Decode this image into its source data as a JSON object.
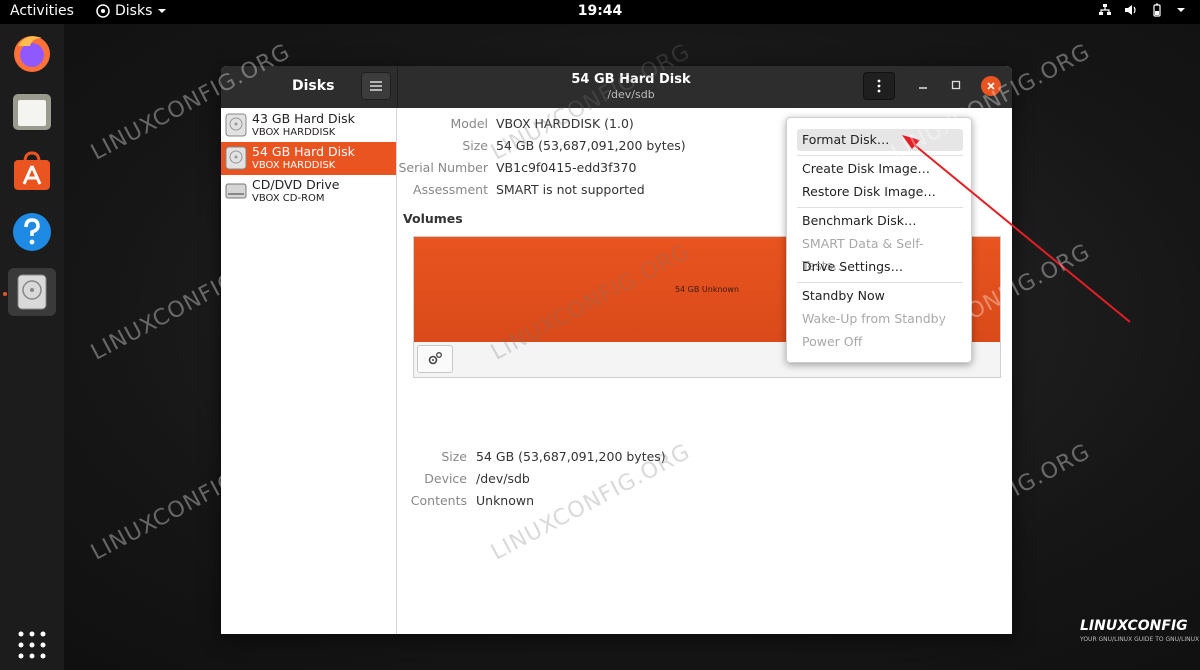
{
  "topbar": {
    "activities": "Activities",
    "app_name": "Disks",
    "clock": "19:44"
  },
  "window": {
    "sidebar_title": "Disks",
    "title": "54 GB Hard Disk",
    "subtitle": "/dev/sdb"
  },
  "disks": [
    {
      "name": "43 GB Hard Disk",
      "sub": "VBOX HARDDISK"
    },
    {
      "name": "54 GB Hard Disk",
      "sub": "VBOX HARDDISK"
    },
    {
      "name": "CD/DVD Drive",
      "sub": "VBOX CD-ROM"
    }
  ],
  "details": {
    "model_label": "Model",
    "model": "VBOX HARDDISK (1.0)",
    "size_label": "Size",
    "size": "54 GB (53,687,091,200 bytes)",
    "serial_label": "Serial Number",
    "serial": "VB1c9f0415-edd3f370",
    "assessment_label": "Assessment",
    "assessment": "SMART is not supported"
  },
  "volumes": {
    "title": "Volumes",
    "partition_label": "54 GB Unknown",
    "size_label": "Size",
    "size": "54 GB (53,687,091,200 bytes)",
    "device_label": "Device",
    "device": "/dev/sdb",
    "contents_label": "Contents",
    "contents": "Unknown"
  },
  "menu": {
    "format": "Format Disk…",
    "create_image": "Create Disk Image…",
    "restore_image": "Restore Disk Image…",
    "benchmark": "Benchmark Disk…",
    "smart": "SMART Data & Self-Tests…",
    "settings": "Drive Settings…",
    "standby": "Standby Now",
    "wakeup": "Wake-Up from Standby",
    "poweroff": "Power Off"
  },
  "watermark": "LINUXCONFIG.ORG",
  "brand": {
    "name": "LINUXCONFIG",
    "tagline": "YOUR GNU/LINUX GUIDE TO GNU/LINUX"
  },
  "colors": {
    "accent": "#e95420",
    "annotation": "#e31e24"
  }
}
